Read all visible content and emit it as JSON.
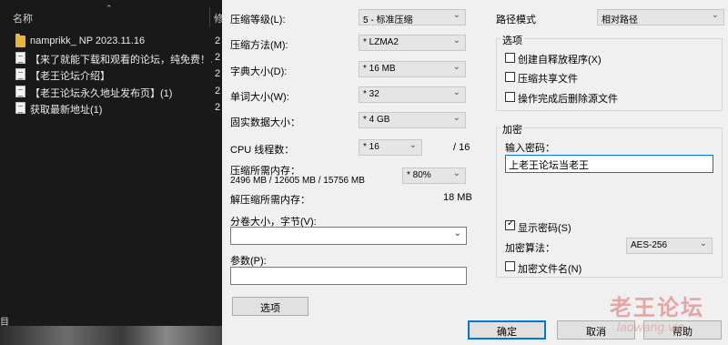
{
  "explorer": {
    "name_column": "名称",
    "date_column": "修",
    "files": [
      {
        "name": "namprikk_ NP 2023.11.16",
        "date": "2",
        "icon": "folder-icon"
      },
      {
        "name": "【来了就能下载和观看的论坛，纯免费！…",
        "date": "2",
        "icon": "text-file-icon"
      },
      {
        "name": "【老王论坛介绍】",
        "date": "2",
        "icon": "text-file-icon"
      },
      {
        "name": "【老王论坛永久地址发布页】(1)",
        "date": "2",
        "icon": "text-file-icon"
      },
      {
        "name": "获取最新地址(1)",
        "date": "2",
        "icon": "text-file-icon"
      }
    ],
    "status": "目"
  },
  "compression": {
    "level_label": "压缩等级(L):",
    "level_value": "5 - 标准压缩",
    "method_label": "压缩方法(M):",
    "method_value": "* LZMA2",
    "dict_label": "字典大小(D):",
    "dict_value": "* 16 MB",
    "word_label": "单词大小(W):",
    "word_value": "* 32",
    "solid_label": "固实数据大小：",
    "solid_value": "* 4 GB",
    "cpu_label": "CPU 线程数：",
    "cpu_value": "* 16",
    "cpu_total": "/ 16",
    "mem_label": "压缩所需内存：",
    "mem_detail": "2496 MB / 12605 MB / 15756 MB",
    "mem_percent": "* 80%",
    "decomp_label": "解压缩所需内存：",
    "decomp_value": "18 MB",
    "split_label": "分卷大小，字节(V):",
    "params_label": "参数(P):",
    "options_button": "选项"
  },
  "path": {
    "label": "路径模式",
    "value": "相对路径"
  },
  "options": {
    "title": "选项",
    "items": [
      {
        "label": "创建自释放程序(X)",
        "checked": false
      },
      {
        "label": "压缩共享文件",
        "checked": false
      },
      {
        "label": "操作完成后删除源文件",
        "checked": false
      }
    ]
  },
  "encryption": {
    "title": "加密",
    "password_label": "输入密码：",
    "password_value": "上老王论坛当老王",
    "show_password": "显示密码(S)",
    "method_label": "加密算法：",
    "method_value": "AES-256",
    "encrypt_names": "加密文件名(N)"
  },
  "buttons": {
    "ok": "确定",
    "cancel": "取消",
    "help": "帮助"
  },
  "watermark": {
    "text": "老王论坛",
    "sub": "laowang.vip"
  }
}
